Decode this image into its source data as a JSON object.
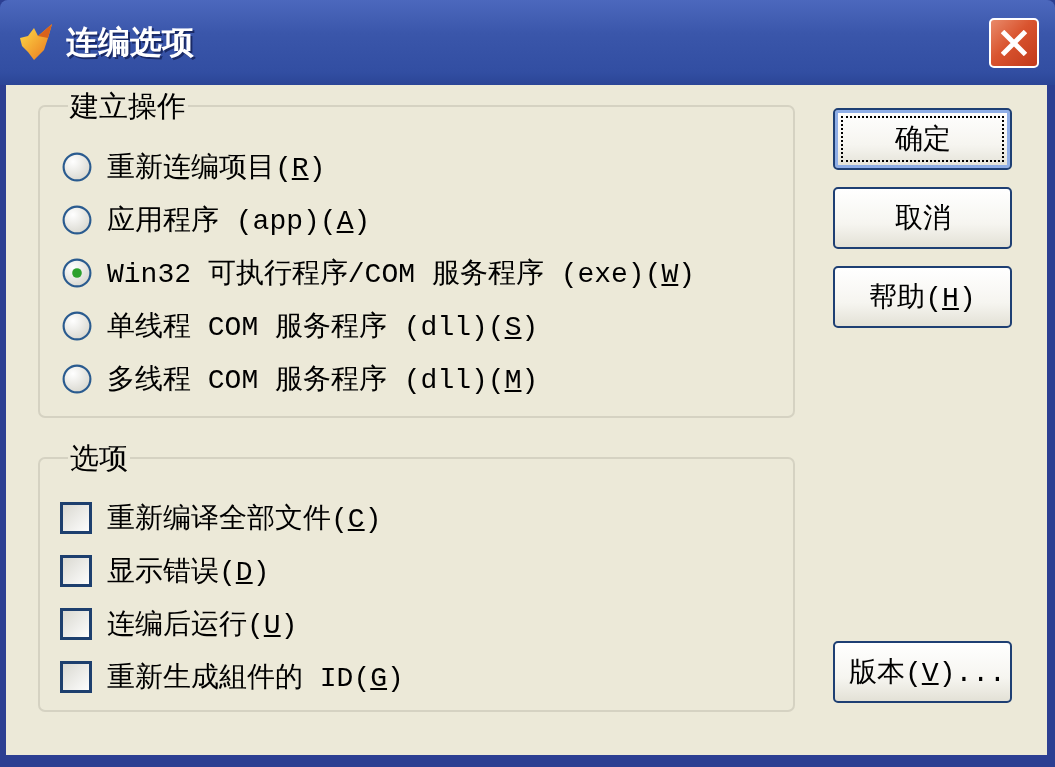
{
  "window": {
    "title": "连编选项"
  },
  "build_action": {
    "label": "建立操作",
    "options": [
      {
        "label": "重新连编项目(",
        "access_key": "R",
        "label_end": ")",
        "selected": false
      },
      {
        "label": "应用程序 (app)(",
        "access_key": "A",
        "label_end": ")",
        "selected": false
      },
      {
        "label": "Win32 可执行程序/COM 服务程序 (exe)(",
        "access_key": "W",
        "label_end": ")",
        "selected": true
      },
      {
        "label": "单线程 COM 服务程序 (dll)(",
        "access_key": "S",
        "label_end": ")",
        "selected": false
      },
      {
        "label": "多线程 COM 服务程序 (dll)(",
        "access_key": "M",
        "label_end": ")",
        "selected": false
      }
    ]
  },
  "options": {
    "label": "选项",
    "items": [
      {
        "label": "重新编译全部文件(",
        "access_key": "C",
        "label_end": ")",
        "checked": false
      },
      {
        "label": "显示错误(",
        "access_key": "D",
        "label_end": ")",
        "checked": false
      },
      {
        "label": "连编后运行(",
        "access_key": "U",
        "label_end": ")",
        "checked": false
      },
      {
        "label": "重新生成組件的 ID(",
        "access_key": "G",
        "label_end": ")",
        "checked": false
      }
    ]
  },
  "buttons": [
    {
      "label": "确定",
      "default": true
    },
    {
      "label": "取消",
      "default": false
    },
    {
      "label": "帮助(",
      "access_key": "H",
      "label_end": ")",
      "default": false
    }
  ],
  "version_button": {
    "label": "版本(",
    "access_key": "V",
    "label_end": ")..."
  }
}
